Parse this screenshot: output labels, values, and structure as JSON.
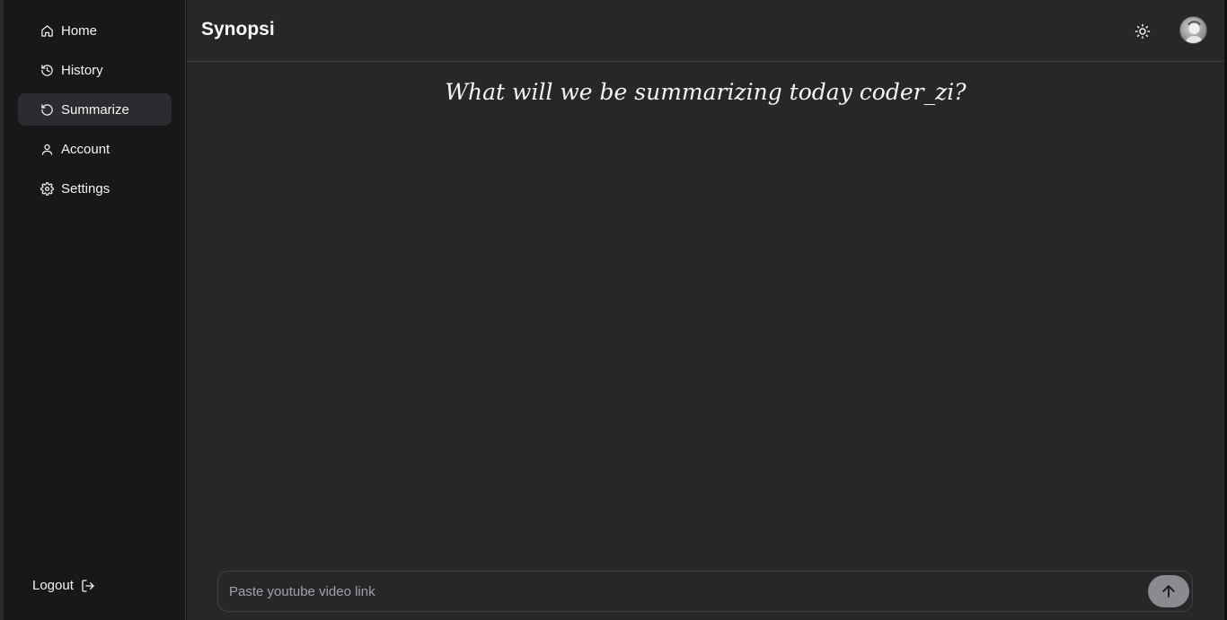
{
  "sidebar": {
    "items": [
      {
        "label": "Home",
        "icon": "home-icon"
      },
      {
        "label": "History",
        "icon": "history-icon"
      },
      {
        "label": "Summarize",
        "icon": "refresh-icon",
        "active": true
      },
      {
        "label": "Account",
        "icon": "user-icon"
      },
      {
        "label": "Settings",
        "icon": "gear-icon"
      }
    ],
    "logout_label": "Logout",
    "logout_icon": "logout-icon"
  },
  "header": {
    "title": "Synopsi",
    "theme_icon": "sun-icon",
    "avatar_icon": "avatar"
  },
  "main": {
    "greeting": "What will we be summarizing today coder_zi?",
    "input_placeholder": "Paste youtube video link",
    "input_value": "",
    "send_icon": "arrow-up-icon"
  },
  "colors": {
    "sidebar_bg": "#18181b",
    "main_bg": "#27272a",
    "active_item_bg": "#2c2c30",
    "send_button_bg": "#8a8a8f"
  }
}
